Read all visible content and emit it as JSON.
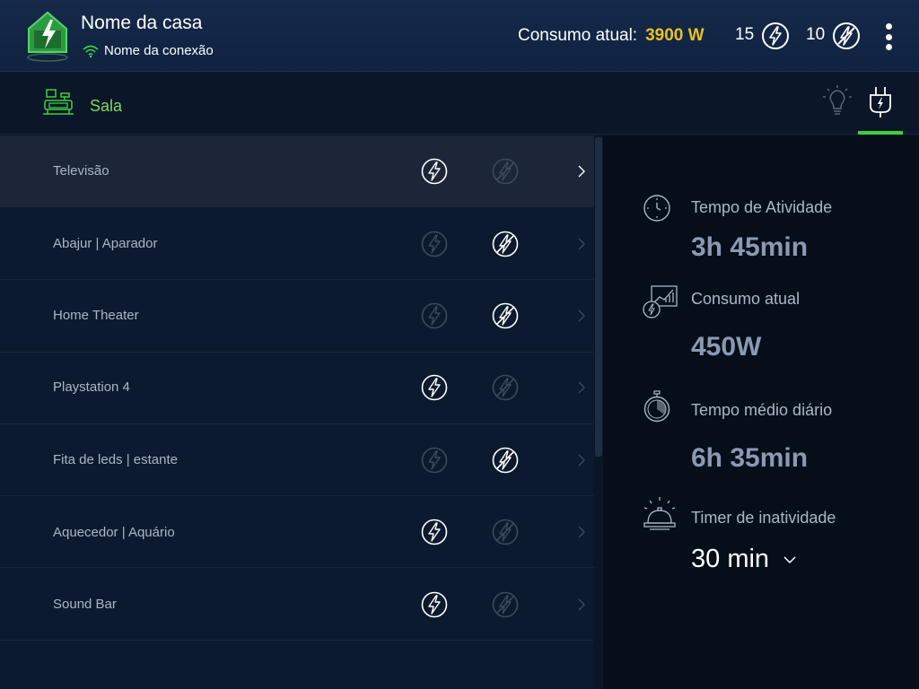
{
  "header": {
    "house_name": "Nome da casa",
    "connection_name": "Nome da conexão",
    "consumption_label": "Consumo atual:",
    "consumption_value": "3900 W",
    "on_count": "15",
    "off_count": "10"
  },
  "room": {
    "name": "Sala"
  },
  "devices": [
    {
      "name": "Televisão",
      "state": "on"
    },
    {
      "name": "Abajur | Aparador",
      "state": "off"
    },
    {
      "name": "Home Theater",
      "state": "off"
    },
    {
      "name": "Playstation 4",
      "state": "on"
    },
    {
      "name": "Fita de leds | estante",
      "state": "off"
    },
    {
      "name": "Aquecedor | Aquário",
      "state": "on"
    },
    {
      "name": "Sound Bar",
      "state": "on"
    }
  ],
  "detail": {
    "activity_label": "Tempo de Atividade",
    "activity_value": "3h 45min",
    "consumption_label": "Consumo atual",
    "consumption_value": "450W",
    "avg_label": "Tempo médio diário",
    "avg_value": "6h 35min",
    "timer_label": "Timer de inatividade",
    "timer_value": "30 min"
  },
  "colors": {
    "accent_green": "#3dd13d",
    "consumption_yellow": "#e7c21e",
    "header_bg": "#15294a",
    "list_bg": "#0c1a2f",
    "detail_bg": "#060e19"
  },
  "icons": [
    "logo-icon",
    "wifi-icon",
    "bolt-on-icon",
    "bolt-off-icon",
    "menu-icon",
    "living-room-icon",
    "bulb-icon",
    "plug-icon",
    "clock-icon",
    "consumption-chart-icon",
    "stopwatch-icon",
    "bell-icon",
    "chevron-right-icon",
    "chevron-down-icon"
  ]
}
